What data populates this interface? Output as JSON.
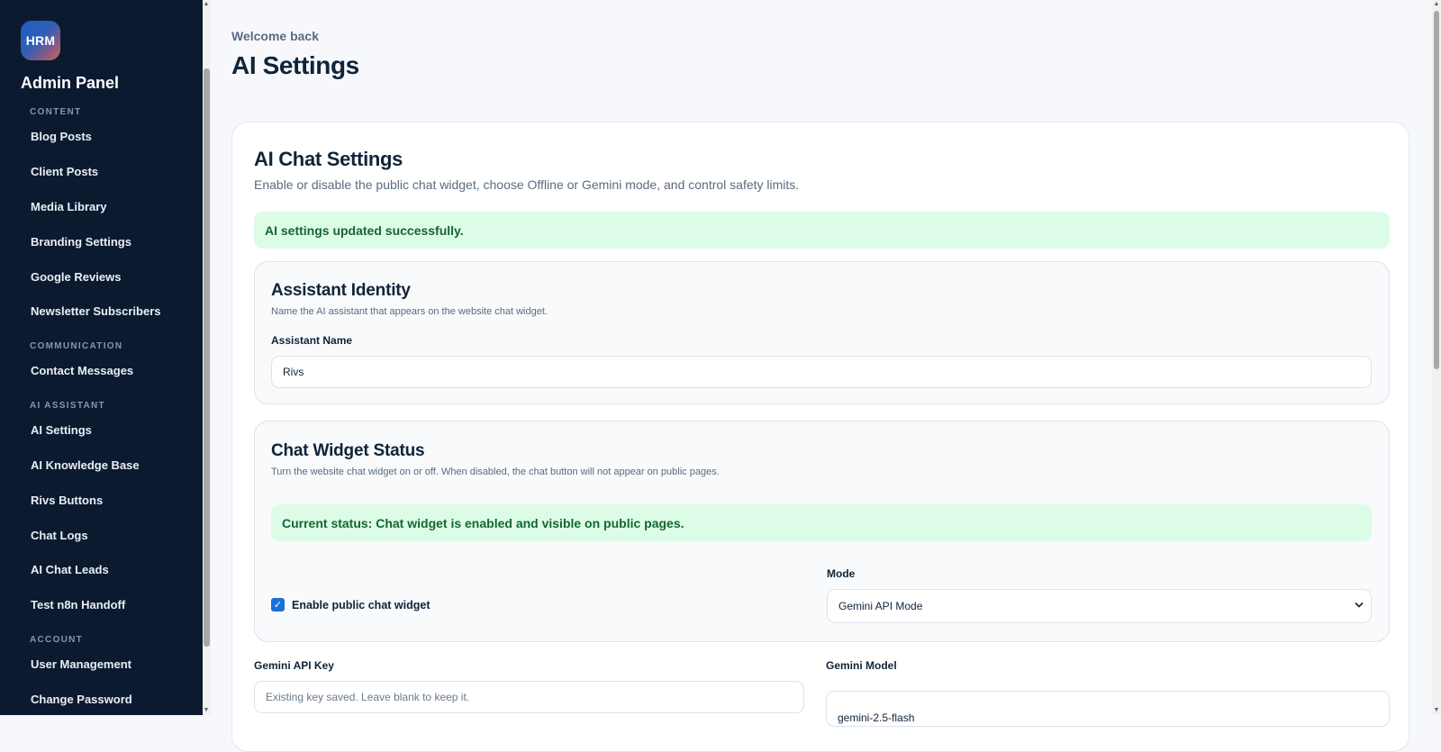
{
  "sidebar": {
    "logo_text": "HRM",
    "title": "Admin Panel",
    "sections": [
      {
        "label": "CONTENT",
        "items": [
          "Blog Posts",
          "Client Posts",
          "Media Library",
          "Branding Settings",
          "Google Reviews",
          "Newsletter Subscribers"
        ]
      },
      {
        "label": "COMMUNICATION",
        "items": [
          "Contact Messages"
        ]
      },
      {
        "label": "AI ASSISTANT",
        "items": [
          "AI Settings",
          "AI Knowledge Base",
          "Rivs Buttons",
          "Chat Logs",
          "AI Chat Leads",
          "Test n8n Handoff"
        ]
      },
      {
        "label": "ACCOUNT",
        "items": [
          "User Management",
          "Change Password"
        ]
      }
    ]
  },
  "header": {
    "welcome": "Welcome back",
    "title": "AI Settings"
  },
  "card": {
    "title": "AI Chat Settings",
    "description": "Enable or disable the public chat widget, choose Offline or Gemini mode, and control safety limits.",
    "success_alert": "AI settings updated successfully."
  },
  "identity": {
    "title": "Assistant Identity",
    "description": "Name the AI assistant that appears on the website chat widget.",
    "name_label": "Assistant Name",
    "name_value": "Rivs"
  },
  "widget": {
    "title": "Chat Widget Status",
    "description": "Turn the website chat widget on or off. When disabled, the chat button will not appear on public pages.",
    "status_alert": "Current status: Chat widget is enabled and visible on public pages.",
    "enable_label": "Enable public chat widget",
    "enabled": true,
    "mode_label": "Mode",
    "mode_value": "Gemini API Mode"
  },
  "gemini": {
    "api_key_label": "Gemini API Key",
    "api_key_placeholder": "Existing key saved. Leave blank to keep it.",
    "model_label": "Gemini Model",
    "model_value": "gemini-2.5-flash"
  },
  "colors": {
    "sidebar_bg": "#0c1a30",
    "accent": "#1a6fd8",
    "success_bg": "#dcfce7",
    "success_text": "#166534"
  }
}
